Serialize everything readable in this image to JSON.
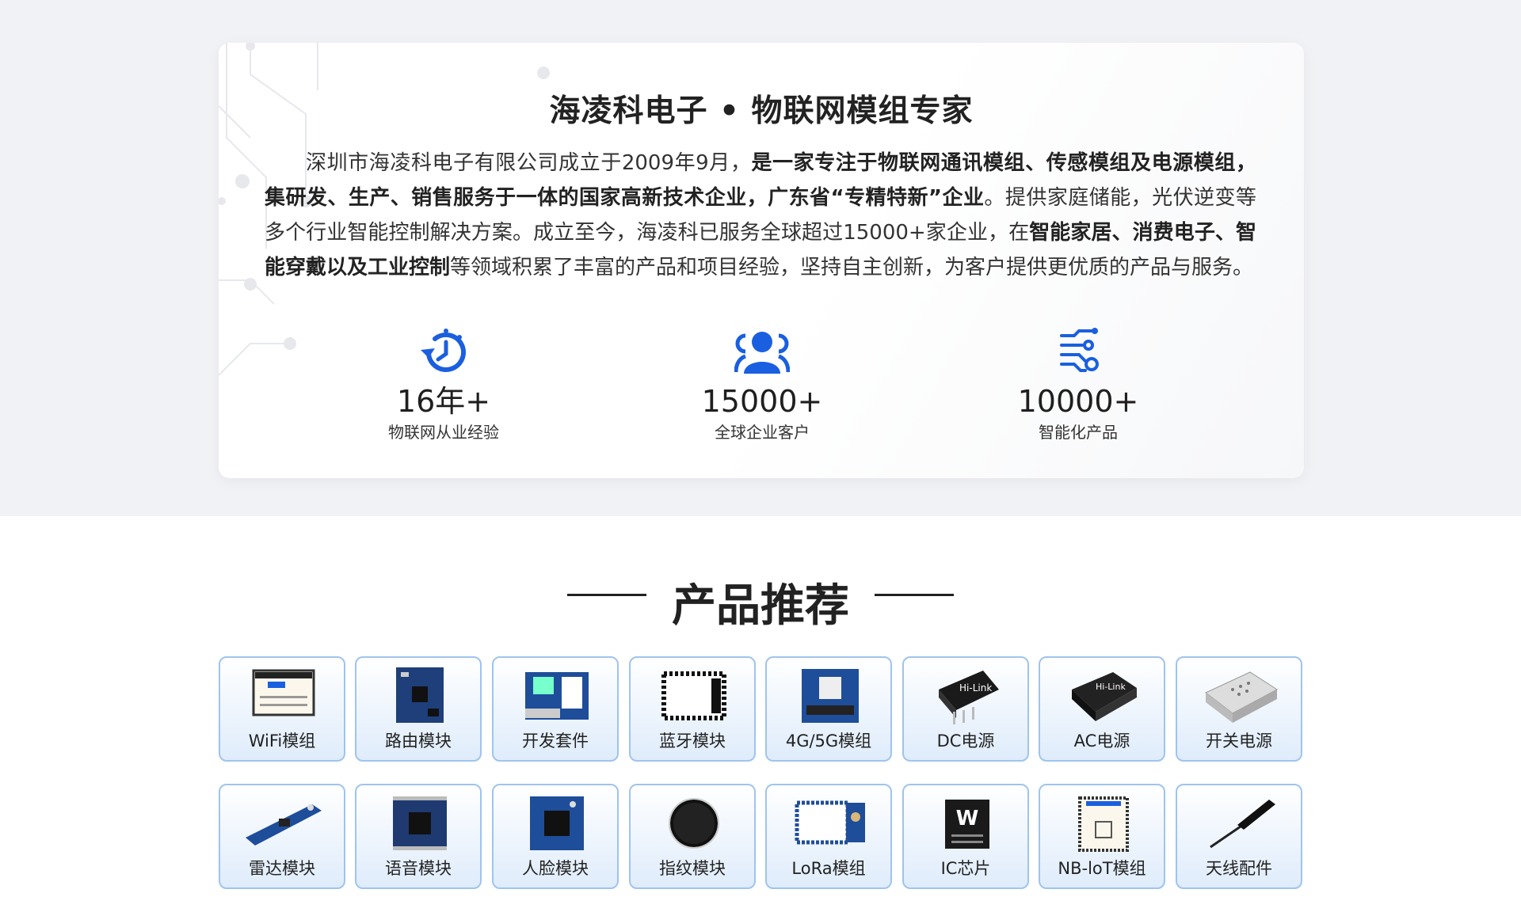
{
  "intro": {
    "title": "海凌科电子 • 物联网模组专家",
    "para": [
      {
        "text": "深圳市海凌科电子有限公司成立于2009年9月，",
        "bold": false
      },
      {
        "text": "是一家专注于物联网通讯模组、传感模组及电源模组，集研发、生产、销售服务于一体的国家高新技术企业，广东省“专精特新”企业",
        "bold": true
      },
      {
        "text": "。提供家庭储能，光伏逆变等多个行业智能控制解决方案。成立至今，海凌科已服务全球超过15000+家企业，在",
        "bold": false
      },
      {
        "text": "智能家居、消费电子、智能穿戴以及工业控制",
        "bold": true
      },
      {
        "text": "等领域积累了丰富的产品和项目经验，坚持自主创新，为客户提供更优质的产品与服务。",
        "bold": false
      }
    ],
    "stats": [
      {
        "number": "16年+",
        "label": "物联网从业经验",
        "icon": "clock-history-icon"
      },
      {
        "number": "15000+",
        "label": "全球企业客户",
        "icon": "users-icon"
      },
      {
        "number": "10000+",
        "label": "智能化产品",
        "icon": "circuit-icon"
      }
    ]
  },
  "products": {
    "title": "产品推荐",
    "items": [
      {
        "label": "WiFi模组",
        "icon": "wifi-module-icon"
      },
      {
        "label": "路由模块",
        "icon": "router-module-icon"
      },
      {
        "label": "开发套件",
        "icon": "dev-kit-icon"
      },
      {
        "label": "蓝牙模块",
        "icon": "bluetooth-module-icon"
      },
      {
        "label": "4G/5G模组",
        "icon": "cellular-module-icon"
      },
      {
        "label": "DC电源",
        "icon": "dc-power-icon"
      },
      {
        "label": "AC电源",
        "icon": "ac-power-icon"
      },
      {
        "label": "开关电源",
        "icon": "switch-power-icon"
      },
      {
        "label": "雷达模块",
        "icon": "radar-module-icon"
      },
      {
        "label": "语音模块",
        "icon": "voice-module-icon"
      },
      {
        "label": "人脸模块",
        "icon": "face-module-icon"
      },
      {
        "label": "指纹模块",
        "icon": "fingerprint-module-icon"
      },
      {
        "label": "LoRa模组",
        "icon": "lora-module-icon"
      },
      {
        "label": "IC芯片",
        "icon": "ic-chip-icon"
      },
      {
        "label": "NB-loT模组",
        "icon": "nbiot-module-icon"
      },
      {
        "label": "天线配件",
        "icon": "antenna-icon"
      }
    ]
  },
  "colors": {
    "accent": "#1a5fe0",
    "tile_border": "#9fc4ef",
    "band": "#f1f2f5"
  }
}
